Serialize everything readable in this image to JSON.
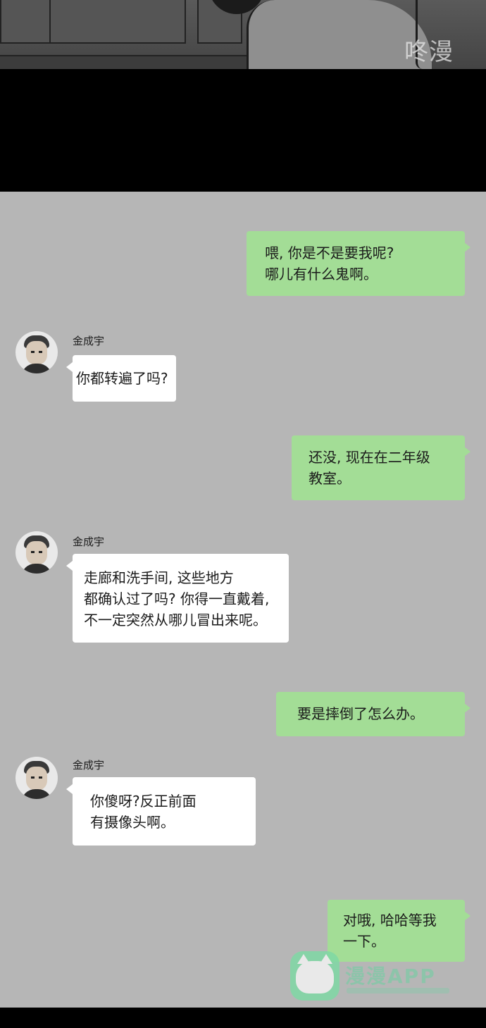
{
  "comic": {
    "watermark_text": "咚漫"
  },
  "contact": {
    "name": "金成宇"
  },
  "messages": [
    {
      "side": "sent",
      "text": "喂, 你是不是要我呢?\n哪儿有什么鬼啊。"
    },
    {
      "side": "recv",
      "sender": "金成宇",
      "text": "你都转遍了吗?"
    },
    {
      "side": "sent",
      "text": "还没, 现在在二年级\n教室。"
    },
    {
      "side": "recv",
      "sender": "金成宇",
      "text": "走廊和洗手间, 这些地方\n都确认过了吗? 你得一直戴着,\n不一定突然从哪儿冒出来呢。"
    },
    {
      "side": "sent",
      "text": "要是摔倒了怎么办。"
    },
    {
      "side": "recv",
      "sender": "金成宇",
      "text": "你傻呀?反正前面\n有摄像头啊。"
    },
    {
      "side": "sent",
      "text": "对哦, 哈哈等我\n一下。"
    }
  ],
  "app_watermark": {
    "label": "漫漫APP"
  },
  "colors": {
    "chat_background": "#b6b6b6",
    "sent_bubble": "#a3dd96",
    "received_bubble": "#ffffff"
  }
}
